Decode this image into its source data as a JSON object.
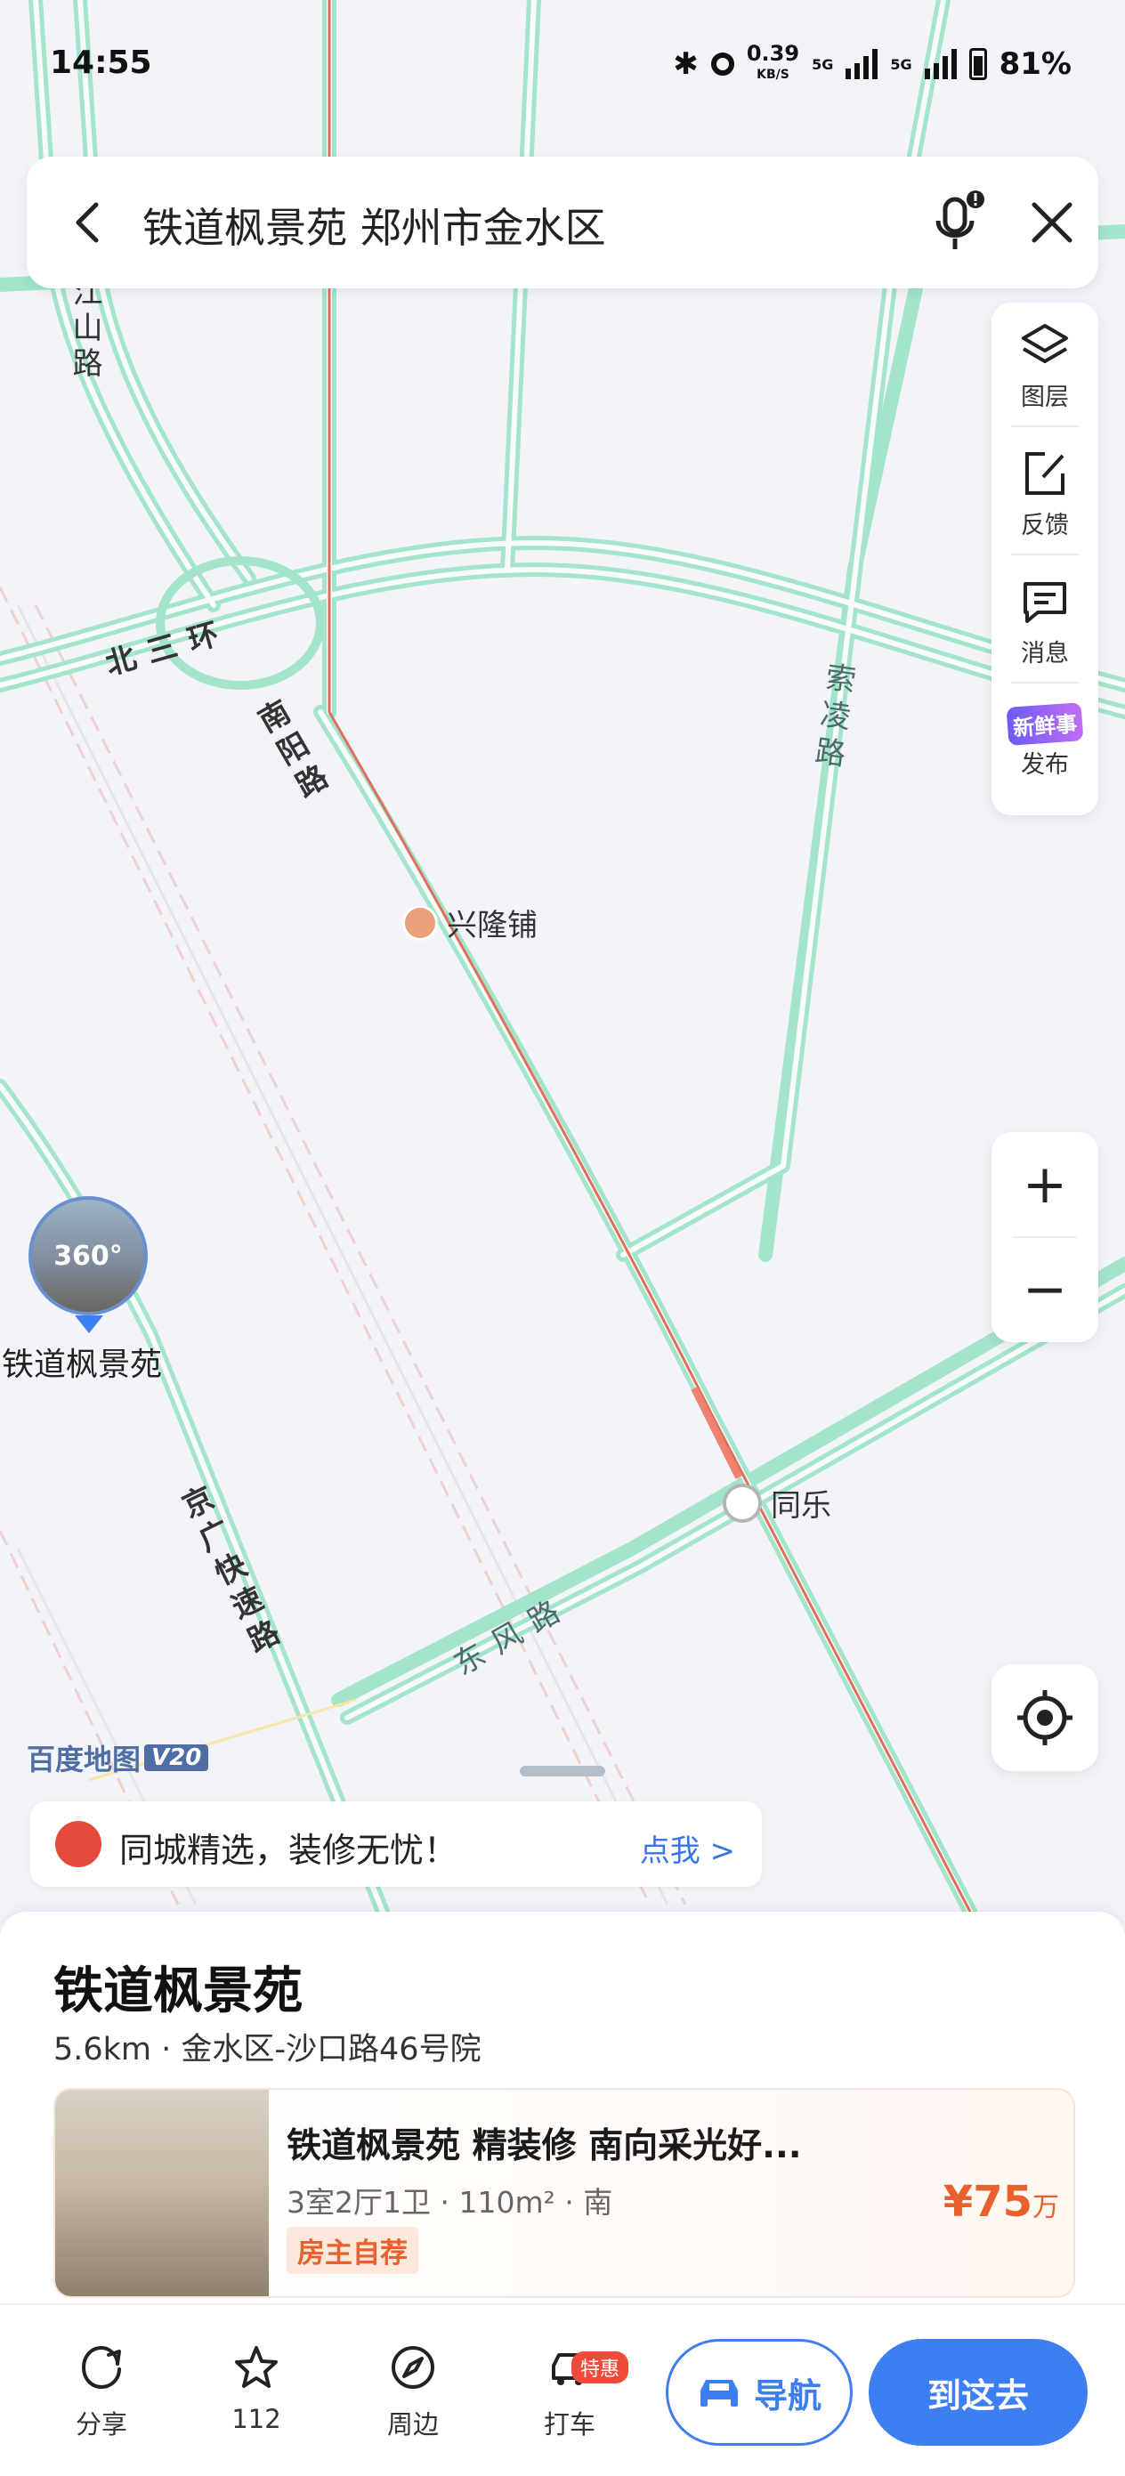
{
  "status_bar": {
    "time": "14:55",
    "speed_value": "0.39",
    "speed_unit": "KB/S",
    "network_1": "5G",
    "network_2": "5G",
    "battery": "81%"
  },
  "search": {
    "query": "铁道枫景苑 郑州市金水区"
  },
  "tools": [
    {
      "label": "图层",
      "icon": "layers-icon"
    },
    {
      "label": "反馈",
      "icon": "feedback-icon"
    },
    {
      "label": "消息",
      "icon": "message-icon"
    },
    {
      "label": "发布",
      "icon": "new-post-icon",
      "badge": "新鲜事"
    }
  ],
  "map": {
    "road_labels": [
      "北三环",
      "南阳路",
      "索凌路",
      "京广快速路",
      "东风路",
      "江山路"
    ],
    "pois": [
      {
        "name": "兴隆铺",
        "type": "metro"
      },
      {
        "name": "同乐",
        "type": "metro"
      }
    ],
    "marker": {
      "label": "铁道枫景苑",
      "panorama": "360°"
    },
    "logo": "百度地图",
    "logo_version": "V20"
  },
  "promo": {
    "text": "同城精选，装修无忧！",
    "link": "点我 >"
  },
  "place": {
    "name": "铁道枫景苑",
    "address": "5.6km · 金水区-沙口路46号院"
  },
  "listing": {
    "title": "铁道枫景苑 精装修 南向采光好...",
    "spec": "3室2厅1卫 · 110m² · 南",
    "tag": "房主自荐",
    "price": "¥75",
    "price_unit": "万"
  },
  "bottom_bar": {
    "share": "分享",
    "favorite_count": "112",
    "nearby": "周边",
    "taxi": "打车",
    "taxi_badge": "特惠",
    "navigate": "导航",
    "go_here": "到这去"
  },
  "colors": {
    "road": "#9ee0c8",
    "route": "#e0705a",
    "primary": "#3d7ef0",
    "price": "#e8602c"
  }
}
